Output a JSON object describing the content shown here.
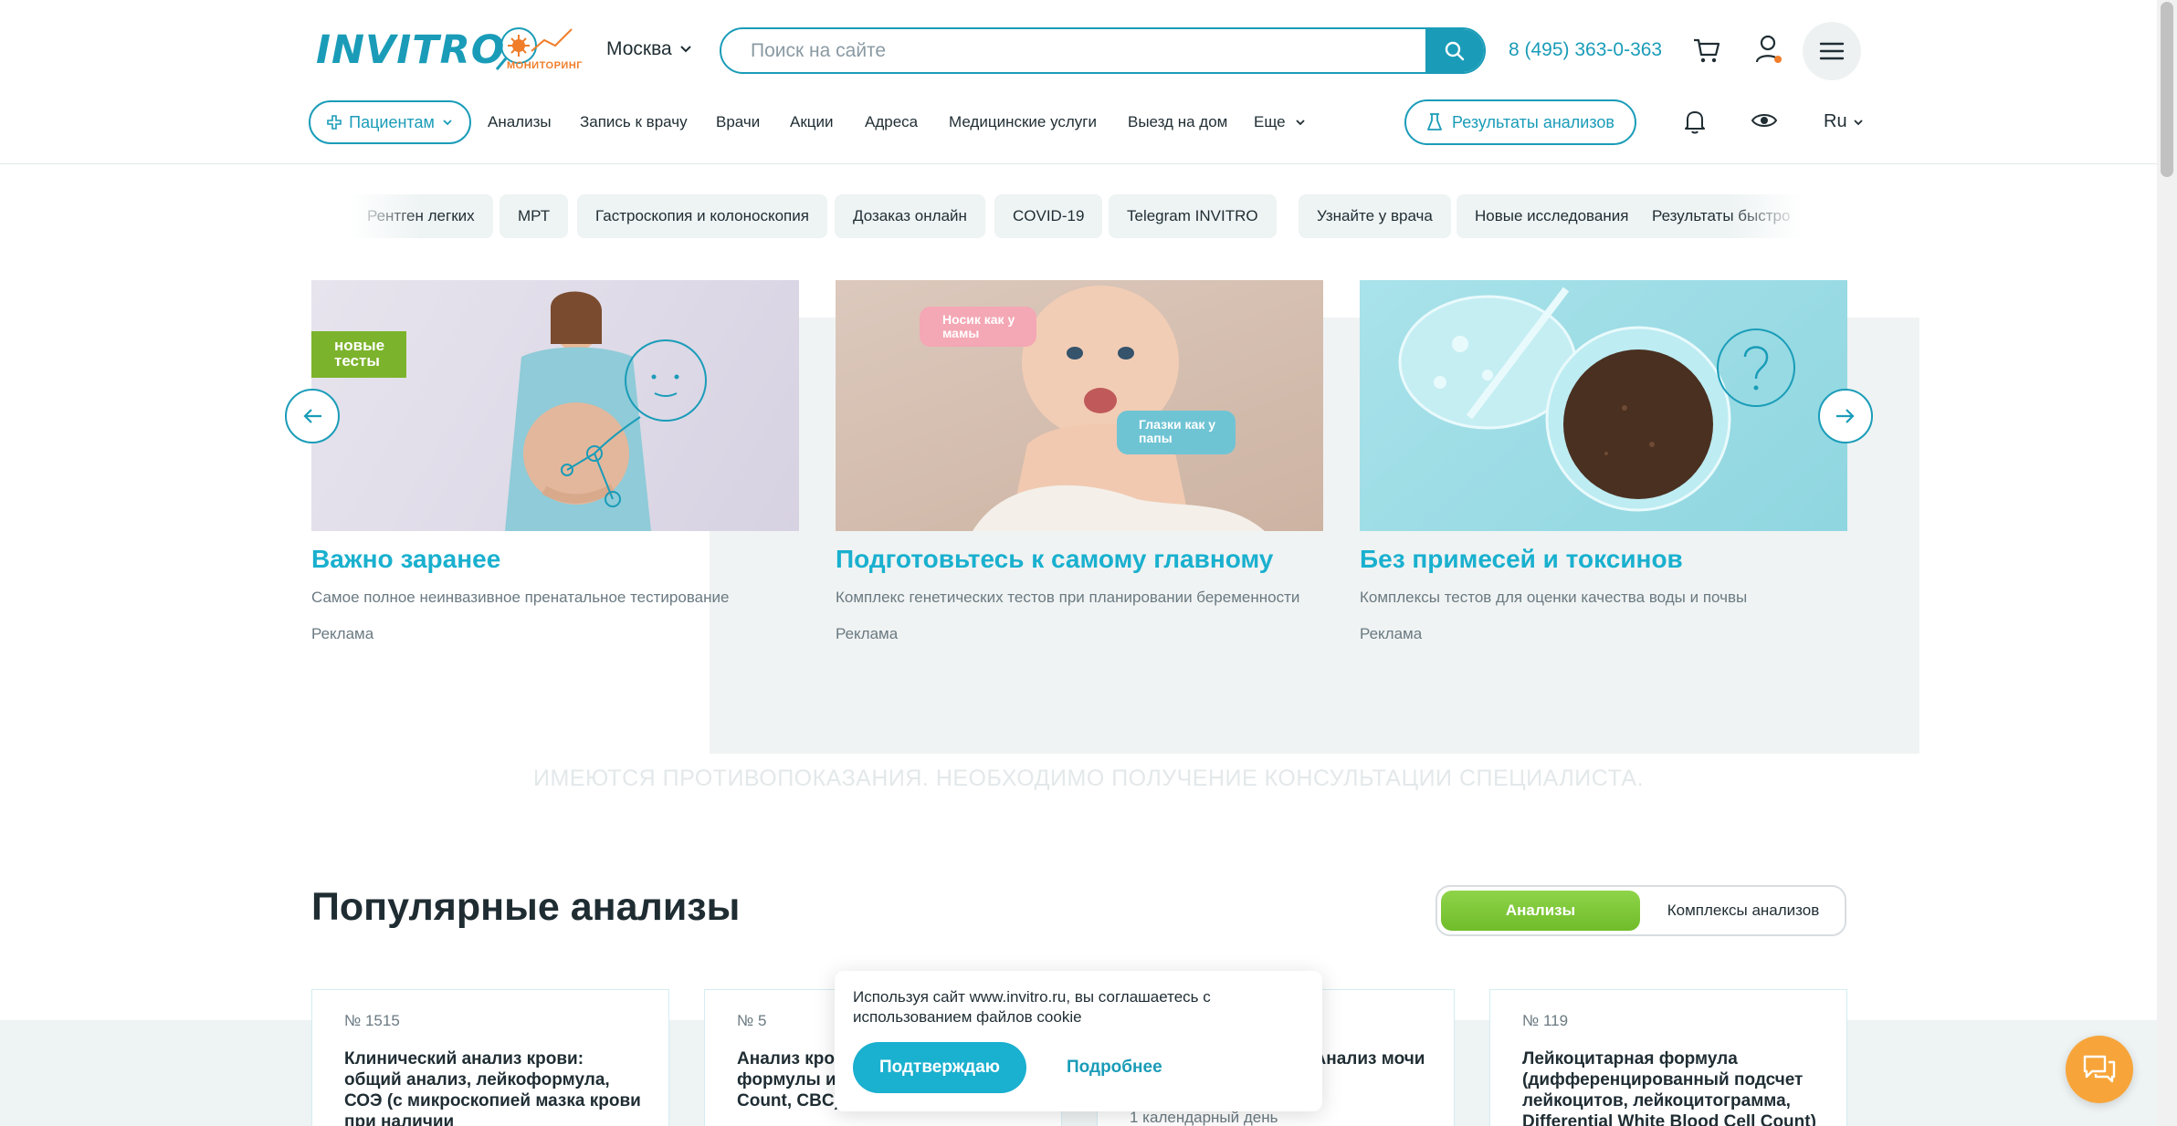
{
  "header": {
    "logo": "INVITRO",
    "monitoring_label": "МОНИТОРИНГ",
    "city": "Москва",
    "search_placeholder": "Поиск на сайте",
    "phone": "8 (495) 363-0-363",
    "icons": [
      "search-icon",
      "cart-icon",
      "user-icon",
      "menu-icon"
    ]
  },
  "nav": {
    "patients": "Пациентам",
    "items": [
      "Анализы",
      "Запись к врачу",
      "Врачи",
      "Акции",
      "Адреса",
      "Медицинские услуги",
      "Выезд на дом",
      "Еще"
    ],
    "results_button": "Результаты анализов",
    "lang": "Ru",
    "icons": [
      "bell-icon",
      "eye-icon",
      "flask-icon"
    ]
  },
  "chips": [
    "Рентген легких",
    "МРТ",
    "Гастроскопия и колоноскопия",
    "Дозаказ онлайн",
    "COVID-19",
    "Telegram INVITRO",
    "Узнайте у врача",
    "Новые исследования",
    "Результаты быстро"
  ],
  "promo": {
    "cards": [
      {
        "title": "Важно заранее",
        "desc": "Самое полное неинвазивное пренатальное тестирование",
        "ad": "Реклама",
        "badge": "новые тесты"
      },
      {
        "title": "Подготовьтесь к самому главному",
        "desc": "Комплекс генетических тестов при планировании беременности",
        "ad": "Реклама",
        "bubble1": "Носик как у мамы",
        "bubble2": "Глазки как у папы"
      },
      {
        "title": "Без примесей и токсинов",
        "desc": "Комплексы тестов для оценки качества воды и почвы",
        "ad": "Реклама"
      }
    ],
    "disclaimer": "ИМЕЮТСЯ ПРОТИВОПОКАЗАНИЯ. НЕОБХОДИМО ПОЛУЧЕНИЕ КОНСУЛЬТАЦИИ СПЕЦИАЛИСТА."
  },
  "popular": {
    "title": "Популярные анализы",
    "tab_active": "Анализы",
    "tab_inactive": "Комплексы анализов",
    "cards": [
      {
        "num": "№ 1515",
        "name": "Клинический анализ крови: общий анализ, лейкоформула, СОЭ (с микроскопией мазка крови при наличии"
      },
      {
        "num": "№ 5",
        "name": "Анализ крови (без лейко формулы и СОЭ) (Complete Blood Count, CBC)"
      },
      {
        "num": "",
        "name": "Общий анализ мочи (Анализ мочи общий)",
        "meta": "1 календарный день"
      },
      {
        "num": "№ 119",
        "name": "Лейкоцитарная формула (дифференцированный подсчет лейкоцитов, лейкоцитограмма, Differential White Blood Cell Count)"
      }
    ]
  },
  "cookie": {
    "text": "Используя сайт www.invitro.ru, вы соглашаетесь с использованием файлов cookie",
    "confirm": "Подтверждаю",
    "more": "Подробнее"
  },
  "colors": {
    "brand": "#1a9cb8",
    "accent_green": "#7cc33a",
    "chat": "#f7a53a"
  }
}
